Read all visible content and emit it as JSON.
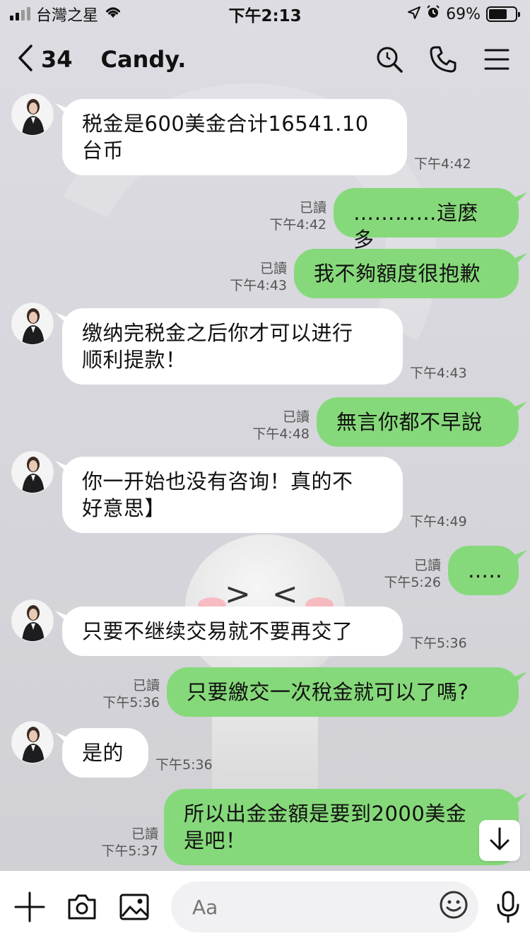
{
  "status_bar": {
    "carrier": "台灣之星",
    "time": "下午2:13",
    "battery": "69%",
    "battery_level": 0.69
  },
  "header": {
    "back_count": "34",
    "title": "Candy.",
    "icons": [
      "search-icon",
      "phone-icon",
      "menu-icon"
    ]
  },
  "messages": [
    {
      "side": "in",
      "text_lines": [
        "税金是600美金合计16541.10",
        "台币"
      ],
      "time": "下午4:42"
    },
    {
      "side": "out",
      "text": "…………這麼多",
      "read": "已讀",
      "time": "下午4:42"
    },
    {
      "side": "out",
      "text": "我不夠額度很抱歉",
      "read": "已讀",
      "time": "下午4:43"
    },
    {
      "side": "in",
      "text_lines": [
        "缴纳完税金之后你才可以进行",
        "顺利提款！"
      ],
      "time": "下午4:43"
    },
    {
      "side": "out",
      "text": "無言你都不早說",
      "read": "已讀",
      "time": "下午4:48"
    },
    {
      "side": "in",
      "text_lines": [
        "你一开始也没有咨询！真的不",
        "好意思】"
      ],
      "time": "下午4:49"
    },
    {
      "side": "out",
      "text": "…..",
      "read": "已讀",
      "time": "下午5:26"
    },
    {
      "side": "in",
      "text": "只要不继续交易就不要再交了",
      "time": "下午5:36"
    },
    {
      "side": "out",
      "text": "只要繳交一次稅金就可以了嗎?",
      "read": "已讀",
      "time": "下午5:36"
    },
    {
      "side": "in",
      "text": "是的",
      "time": "下午5:36"
    },
    {
      "side": "out",
      "text_lines": [
        "所以出金金額是要到2000美金",
        "是吧！"
      ],
      "read": "已讀",
      "time": "下午5:37"
    }
  ],
  "input": {
    "placeholder": "Aa"
  },
  "colors": {
    "outgoing_bubble": "#86d97a",
    "incoming_bubble": "#ffffff"
  }
}
